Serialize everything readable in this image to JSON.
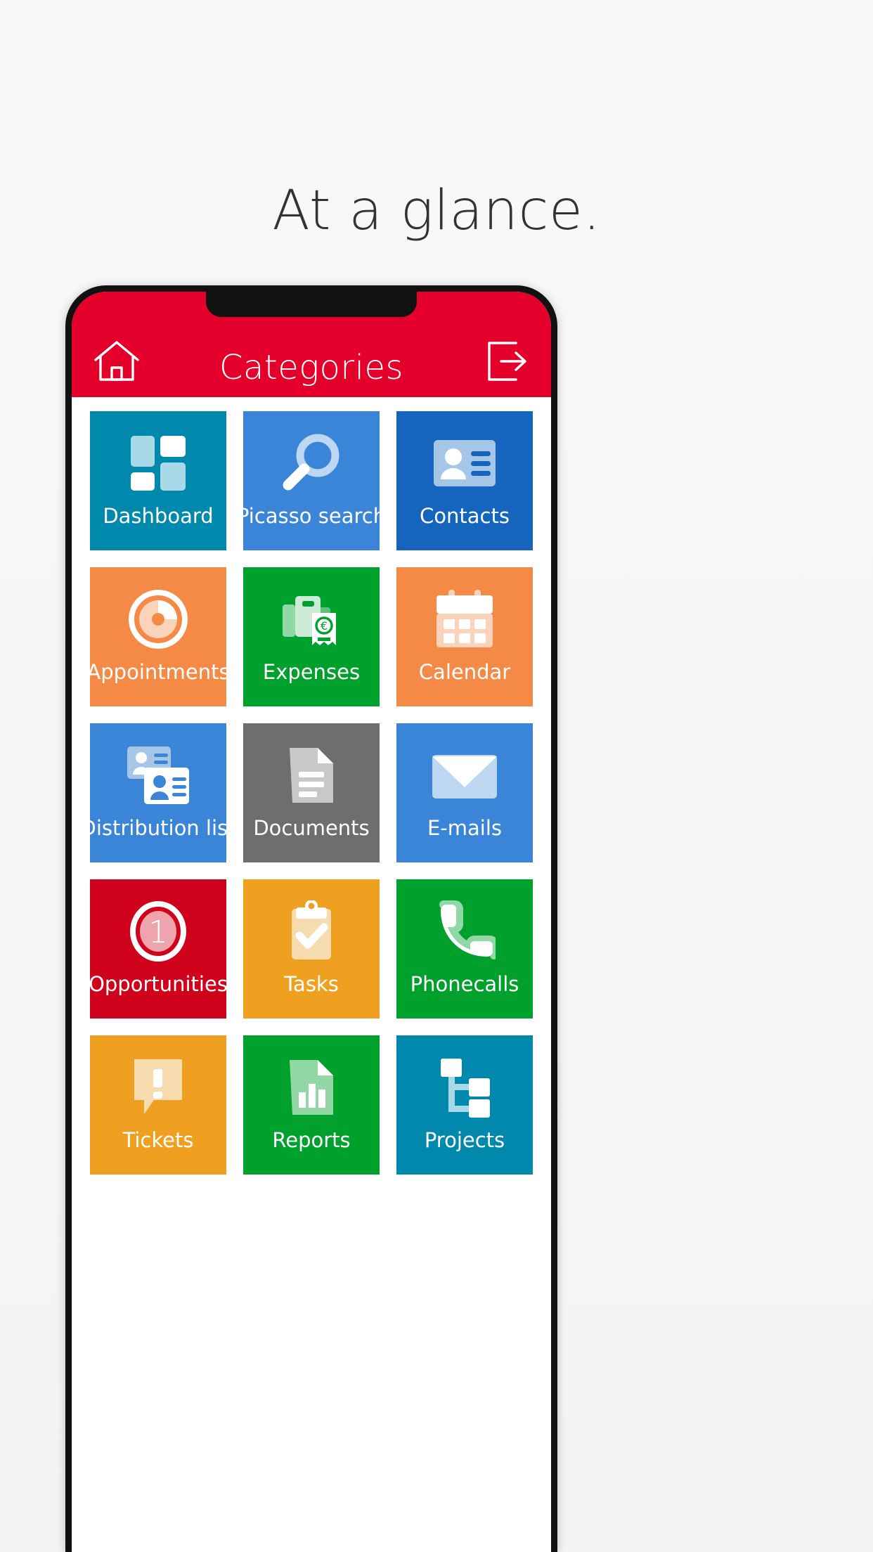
{
  "page": {
    "headline": "At a glance."
  },
  "appbar": {
    "title": "Categories",
    "background_color": "#E4002B",
    "home_icon": "home-icon",
    "logout_icon": "logout-icon"
  },
  "grid": {
    "tiles": [
      {
        "label": "Dashboard",
        "icon": "dashboard-icon",
        "color": "#0089AD",
        "accent": "#A8D9E8"
      },
      {
        "label": "Picasso search",
        "icon": "magnifier-icon",
        "color": "#3A85D8",
        "accent": "#BDD7F2"
      },
      {
        "label": "Contacts",
        "icon": "contact-card-icon",
        "color": "#1565BE",
        "accent": "#A6C6E8"
      },
      {
        "label": "Appointments",
        "icon": "appointment-dial-icon",
        "color": "#F58A46",
        "accent": "#FBD3BA"
      },
      {
        "label": "Expenses",
        "icon": "expenses-receipt-icon",
        "color": "#00A02D",
        "accent": "#92D8A6"
      },
      {
        "label": "Calendar",
        "icon": "calendar-icon",
        "color": "#F58A46",
        "accent": "#FBD3BA"
      },
      {
        "label": "Distribution list",
        "icon": "distribution-list-icon",
        "color": "#3A85D8",
        "accent": "#A6C6E8"
      },
      {
        "label": "Documents",
        "icon": "document-icon",
        "color": "#6E6E6E",
        "accent": "#C8C8C8"
      },
      {
        "label": "E-mails",
        "icon": "envelope-icon",
        "color": "#3A85D8",
        "accent": "#BDD7F2"
      },
      {
        "label": "Opportunities",
        "icon": "opportunity-badge-icon",
        "color": "#D0021B",
        "accent": "#EFA3AC",
        "badge": "1"
      },
      {
        "label": "Tasks",
        "icon": "clipboard-check-icon",
        "color": "#EFA020",
        "accent": "#F7DCB0"
      },
      {
        "label": "Phonecalls",
        "icon": "phone-handset-icon",
        "color": "#00A02D",
        "accent": "#92D8A6"
      },
      {
        "label": "Tickets",
        "icon": "ticket-alert-icon",
        "color": "#EFA020",
        "accent": "#F7DCB0"
      },
      {
        "label": "Reports",
        "icon": "report-chart-icon",
        "color": "#00A02D",
        "accent": "#92D8A6"
      },
      {
        "label": "Projects",
        "icon": "project-tree-icon",
        "color": "#0089AD",
        "accent": "#A8D9E8"
      }
    ]
  }
}
